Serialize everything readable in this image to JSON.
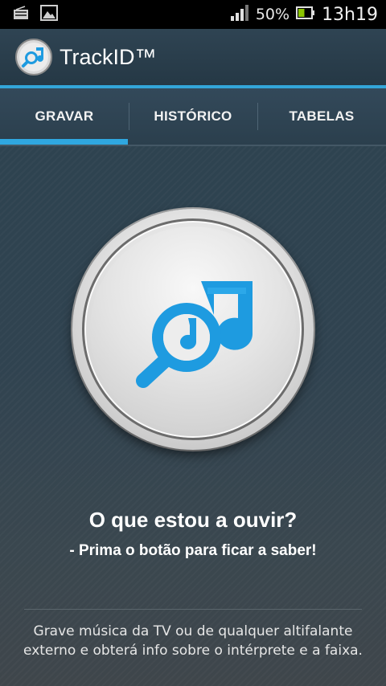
{
  "status_bar": {
    "left_icons": [
      "radio-icon",
      "image-icon"
    ],
    "signal_icon": "signal-bars-icon",
    "battery_percent": "50%",
    "battery_level": 0.5,
    "time": "13h19"
  },
  "app": {
    "logo_icon": "trackid-logo-icon",
    "title": "TrackID™"
  },
  "tabs": [
    {
      "label": "GRAVAR",
      "selected": true
    },
    {
      "label": "HISTÓRICO",
      "selected": false
    },
    {
      "label": "TABELAS",
      "selected": false
    }
  ],
  "main": {
    "record_button_icon": "search-music-note-icon",
    "question": "O que estou a ouvir?",
    "hint": "- Prima o botão para ficar a saber!",
    "info_line1": "Grave música da TV ou de qualquer altifalante",
    "info_line2": "externo e obterá info sobre o intérprete e a faixa."
  },
  "colors": {
    "accent": "#33a5d8",
    "icon_blue": "#1e9be0",
    "background": "#2e4350"
  }
}
